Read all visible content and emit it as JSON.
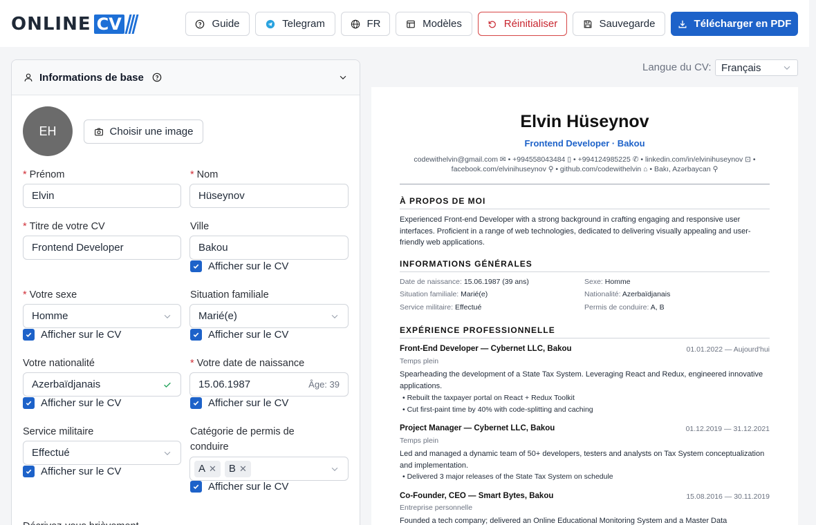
{
  "header": {
    "logo_left": "ONLINE",
    "logo_right": "CV",
    "buttons": {
      "guide": "Guide",
      "telegram": "Telegram",
      "lang": "FR",
      "templates": "Modèles",
      "reset": "Réinitialiser",
      "save": "Sauvegarde",
      "download": "Télécharger en PDF"
    },
    "colors": {
      "primary": "#1d62c9",
      "danger": "#c8262f"
    }
  },
  "form": {
    "section_title": "Informations de base",
    "avatar_initials": "EH",
    "choose_image": "Choisir une image",
    "first_name_label": "Prénom",
    "first_name": "Elvin",
    "last_name_label": "Nom",
    "last_name": "Hüseynov",
    "cv_title_label": "Titre de votre CV",
    "cv_title": "Frontend Developer",
    "city_label": "Ville",
    "city": "Bakou",
    "show_on_cv": "Afficher sur le CV",
    "gender_label": "Votre sexe",
    "gender": "Homme",
    "marital_label": "Situation familiale",
    "marital": "Marié(e)",
    "nationality_label": "Votre nationalité",
    "nationality": "Azerbaïdjanais",
    "birth_label": "Votre date de naissance",
    "birth_date": "15.06.1987",
    "age_label": "Âge: 39",
    "military_label": "Service militaire",
    "military": "Effectué",
    "license_label": "Catégorie de permis de conduire",
    "license_tags": [
      "A",
      "B"
    ],
    "about_label": "Décrivez-vous brièvement"
  },
  "preview": {
    "lang_label": "Langue du CV:",
    "lang_value": "Français",
    "name": "Elvin Hüseynov",
    "role": "Frontend Developer · Bakou",
    "contacts_line1": "codewithelvin@gmail.com ✉ • +994558043484 ▯ • +994124985225 ✆ • linkedin.com/in/elvinihuseynov ⊡ •",
    "contacts_line2": "facebook.com/elvinihuseynov ⚲ • github.com/codewithelvin ⌂ • Bakı, Azərbaycan ⚲",
    "about_title": "À PROPOS DE MOI",
    "about_text": "Experienced Front-end Developer with a strong background in crafting engaging and responsive user interfaces. Proficient in a range of web technologies, dedicated to delivering visually appealing and user-friendly web applications.",
    "general_title": "INFORMATIONS GÉNÉRALES",
    "general": [
      {
        "k": "Date de naissance:",
        "v": "15.06.1987 (39 ans)"
      },
      {
        "k": "Sexe:",
        "v": "Homme"
      },
      {
        "k": "Situation familiale:",
        "v": "Marié(e)"
      },
      {
        "k": "Nationalité:",
        "v": "Azerbaïdjanais"
      },
      {
        "k": "Service militaire:",
        "v": "Effectué"
      },
      {
        "k": "Permis de conduire:",
        "v": "A, B"
      }
    ],
    "experience_title": "EXPÉRIENCE PROFESSIONNELLE",
    "jobs": [
      {
        "title": "Front-End Developer — Cybernet LLC, Bakou",
        "date": "01.01.2022 — Aujourd'hui",
        "type": "Temps plein",
        "desc": "Spearheading the development of a State Tax System. Leveraging React and Redux, engineered innovative applications.",
        "bullets": [
          "Rebuilt the taxpayer portal on React + Redux Toolkit",
          "Cut first-paint time by 40% with code-splitting and caching"
        ]
      },
      {
        "title": "Project Manager — Cybernet LLC, Bakou",
        "date": "01.12.2019 — 31.12.2021",
        "type": "Temps plein",
        "desc": "Led and managed a dynamic team of 50+ developers, testers and analysts on Tax System conceptualization and implementation.",
        "bullets": [
          "Delivered 3 major releases of the State Tax System on schedule"
        ]
      },
      {
        "title": "Co-Founder, CEO — Smart Bytes, Bakou",
        "date": "15.08.2016 — 30.11.2019",
        "type": "Entreprise personnelle",
        "desc": "Founded a tech company; delivered an Online Educational Monitoring System and a Master Data",
        "bullets": []
      }
    ]
  }
}
